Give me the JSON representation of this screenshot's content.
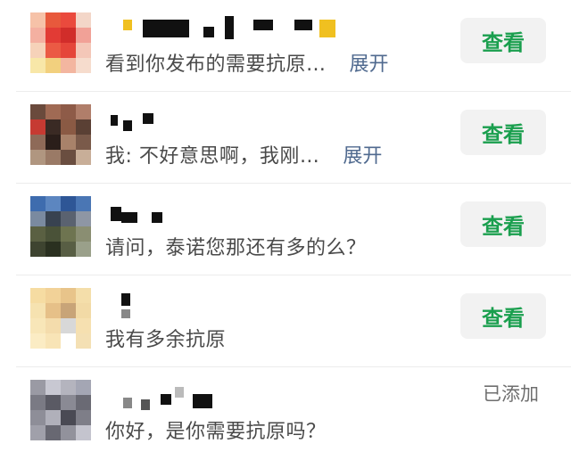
{
  "requests": [
    {
      "message": "看到你发布的需要抗原…",
      "expand_label": "展开",
      "action_label": "查看",
      "avatar_colors": [
        "#f6c2a8",
        "#e8593c",
        "#ea4a3d",
        "#f3d6c8",
        "#f4b0a1",
        "#e23b35",
        "#d12d2a",
        "#f1a197",
        "#f6d2b9",
        "#eb5a44",
        "#e5463a",
        "#f4c7b8",
        "#f8e7a8",
        "#f2d07e",
        "#f3b6a0",
        "#f6dccd"
      ]
    },
    {
      "message": "我: 不好意思啊，我刚…",
      "expand_label": "展开",
      "action_label": "查看",
      "avatar_colors": [
        "#6a4a3c",
        "#a06a54",
        "#8e5b48",
        "#b07e6a",
        "#c63a32",
        "#3a2a24",
        "#8a5a44",
        "#5a4034",
        "#8e6a58",
        "#2a1e1a",
        "#a8826a",
        "#7a5a4a",
        "#b09680",
        "#9a7a66",
        "#6a4e40",
        "#c8ae98"
      ]
    },
    {
      "message": "请问，泰诺您那还有多的么？",
      "action_label": "查看",
      "avatar_colors": [
        "#3e6cae",
        "#5c86c0",
        "#2e5696",
        "#4a76b4",
        "#7a8aa0",
        "#384250",
        "#5a6270",
        "#8e96a4",
        "#5a6042",
        "#4a5238",
        "#6e7450",
        "#8a8e72",
        "#3e4430",
        "#2a3020",
        "#585e44",
        "#9aa08a"
      ]
    },
    {
      "message": "我有多余抗原",
      "action_label": "查看",
      "avatar_colors": [
        "#f6dca2",
        "#f2d298",
        "#e8c48a",
        "#f4deaa",
        "#f6e2b0",
        "#e6c088",
        "#c8a478",
        "#f2daa6",
        "#f8e6b8",
        "#f4dcac",
        "#d8d8d8",
        "#f6e0b0",
        "#fbecc4",
        "#f8e4b6",
        "#ffffff",
        "#f4e0b4"
      ]
    },
    {
      "message": "你好，是你需要抗原吗？",
      "status_label": "已添加",
      "avatar_colors": [
        "#9a9aa4",
        "#c8c8d2",
        "#b4b4be",
        "#a4a6b4",
        "#7a7a84",
        "#5a5a64",
        "#8a8a94",
        "#6a6a74",
        "#8e8e98",
        "#b0b0ba",
        "#4a4a54",
        "#7e7e88",
        "#a0a0aa",
        "#686872",
        "#92929c",
        "#c4c4ce"
      ]
    }
  ]
}
